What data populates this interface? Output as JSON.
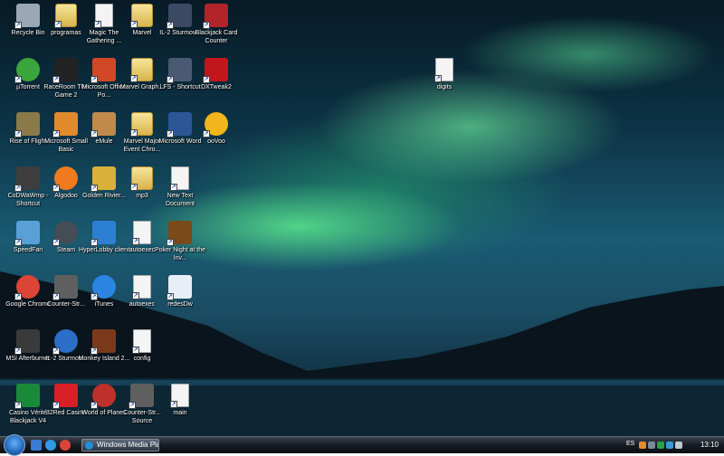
{
  "desktop": {
    "icons": [
      {
        "label": "Recycle Bin",
        "icon": "recycle-bin-icon",
        "color": "#9aa7b5"
      },
      {
        "label": "programas",
        "icon": "folder-icon",
        "color": "#e6c35c"
      },
      {
        "label": "Magic The Gathering ...",
        "icon": "document-icon",
        "color": "#ffffff"
      },
      {
        "label": "Marvel",
        "icon": "folder-icon",
        "color": "#e6c35c"
      },
      {
        "label": "IL-2 Sturmov...",
        "icon": "game-icon",
        "color": "#3a4a62"
      },
      {
        "label": "Blackjack Card Counter",
        "icon": "blackjack-icon",
        "color": "#b3232a"
      },
      {
        "label": "µTorrent",
        "icon": "utorrent-icon",
        "color": "#3aa53a"
      },
      {
        "label": "RaceRoom The Game 2",
        "icon": "raceroom-icon",
        "color": "#222222"
      },
      {
        "label": "Microsoft Office Po...",
        "icon": "powerpoint-icon",
        "color": "#d24726"
      },
      {
        "label": "Marvel Graph...",
        "icon": "folder-icon",
        "color": "#e6c35c"
      },
      {
        "label": "LFS - Shortcut",
        "icon": "lfs-icon",
        "color": "#4a5a72"
      },
      {
        "label": "DXTweak2",
        "icon": "dxtweak-icon",
        "color": "#c0161c"
      },
      {
        "label": "digits",
        "icon": "document-icon",
        "color": "#ffffff"
      },
      {
        "label": "Rise of Flight",
        "icon": "rise-of-flight-icon",
        "color": "#8a7a48"
      },
      {
        "label": "Microsoft Small Basic",
        "icon": "small-basic-icon",
        "color": "#e08a2c"
      },
      {
        "label": "eMule",
        "icon": "emule-icon",
        "color": "#c08a4a"
      },
      {
        "label": "Marvel Major Event Chro...",
        "icon": "folder-icon",
        "color": "#e6c35c"
      },
      {
        "label": "Microsoft Word",
        "icon": "word-icon",
        "color": "#2b5797"
      },
      {
        "label": "ooVoo",
        "icon": "oovoo-icon",
        "color": "#f2b51b"
      },
      {
        "label": "CoDWaWmp - Shortcut",
        "icon": "cod-icon",
        "color": "#3d3d3d"
      },
      {
        "label": "Algodoo",
        "icon": "algodoo-icon",
        "color": "#ef7a1f"
      },
      {
        "label": "Golden Rivier...",
        "icon": "golden-riviera-icon",
        "color": "#d9b13a"
      },
      {
        "label": "mp3",
        "icon": "folder-icon",
        "color": "#e6c35c"
      },
      {
        "label": "New Text Document",
        "icon": "document-icon",
        "color": "#ffffff"
      },
      {
        "label": "SpeedFan",
        "icon": "speedfan-icon",
        "color": "#5aa0d8"
      },
      {
        "label": "Steam",
        "icon": "steam-icon",
        "color": "#444c56"
      },
      {
        "label": "HyperLobby client",
        "icon": "hyperlobby-icon",
        "color": "#2d7fd3"
      },
      {
        "label": "autoexec",
        "icon": "config-file-icon",
        "color": "#e8eef6"
      },
      {
        "label": "Poker Night at the Inv...",
        "icon": "poker-icon",
        "color": "#7a4a1a"
      },
      {
        "label": "Google Chrome",
        "icon": "chrome-icon",
        "color": "#db4437"
      },
      {
        "label": "Counter-Str...",
        "icon": "counter-strike-icon",
        "color": "#5f5f5f"
      },
      {
        "label": "iTunes",
        "icon": "itunes-icon",
        "color": "#2a84e0"
      },
      {
        "label": "autoexec",
        "icon": "config-file-icon",
        "color": "#e8eef6"
      },
      {
        "label": "redesDw",
        "icon": "redes-icon",
        "color": "#e8eef6"
      },
      {
        "label": "MSI Afterburner",
        "icon": "afterburner-icon",
        "color": "#3a3a3a"
      },
      {
        "label": "IL-2 Sturmov...",
        "icon": "il2-icon",
        "color": "#2a6ec8"
      },
      {
        "label": "Monkey Island 2...",
        "icon": "monkey-island-icon",
        "color": "#7a3a1a"
      },
      {
        "label": "config",
        "icon": "config-file-icon",
        "color": "#e8eef6"
      },
      {
        "label": "Casino Vérité Blackjack V4",
        "icon": "casino-icon",
        "color": "#1a8a3a"
      },
      {
        "label": "32Red Casino",
        "icon": "32red-icon",
        "color": "#d81f26"
      },
      {
        "label": "World of Planes",
        "icon": "world-of-planes-icon",
        "color": "#c0302a"
      },
      {
        "label": "Counter-Str... Source",
        "icon": "counter-strike-source-icon",
        "color": "#5f5f5f"
      },
      {
        "label": "main",
        "icon": "document-icon",
        "color": "#ffffff"
      }
    ]
  },
  "taskbar": {
    "start_label": "Start",
    "quick_launch": [
      "show-desktop-icon",
      "ie-icon",
      "chrome-quicklaunch-icon"
    ],
    "window_button": "Windows Media Pla...",
    "language": "ES",
    "clock": "13:10"
  },
  "colors": {
    "taskbar": "#161b22",
    "accent": "#1b58a8"
  }
}
